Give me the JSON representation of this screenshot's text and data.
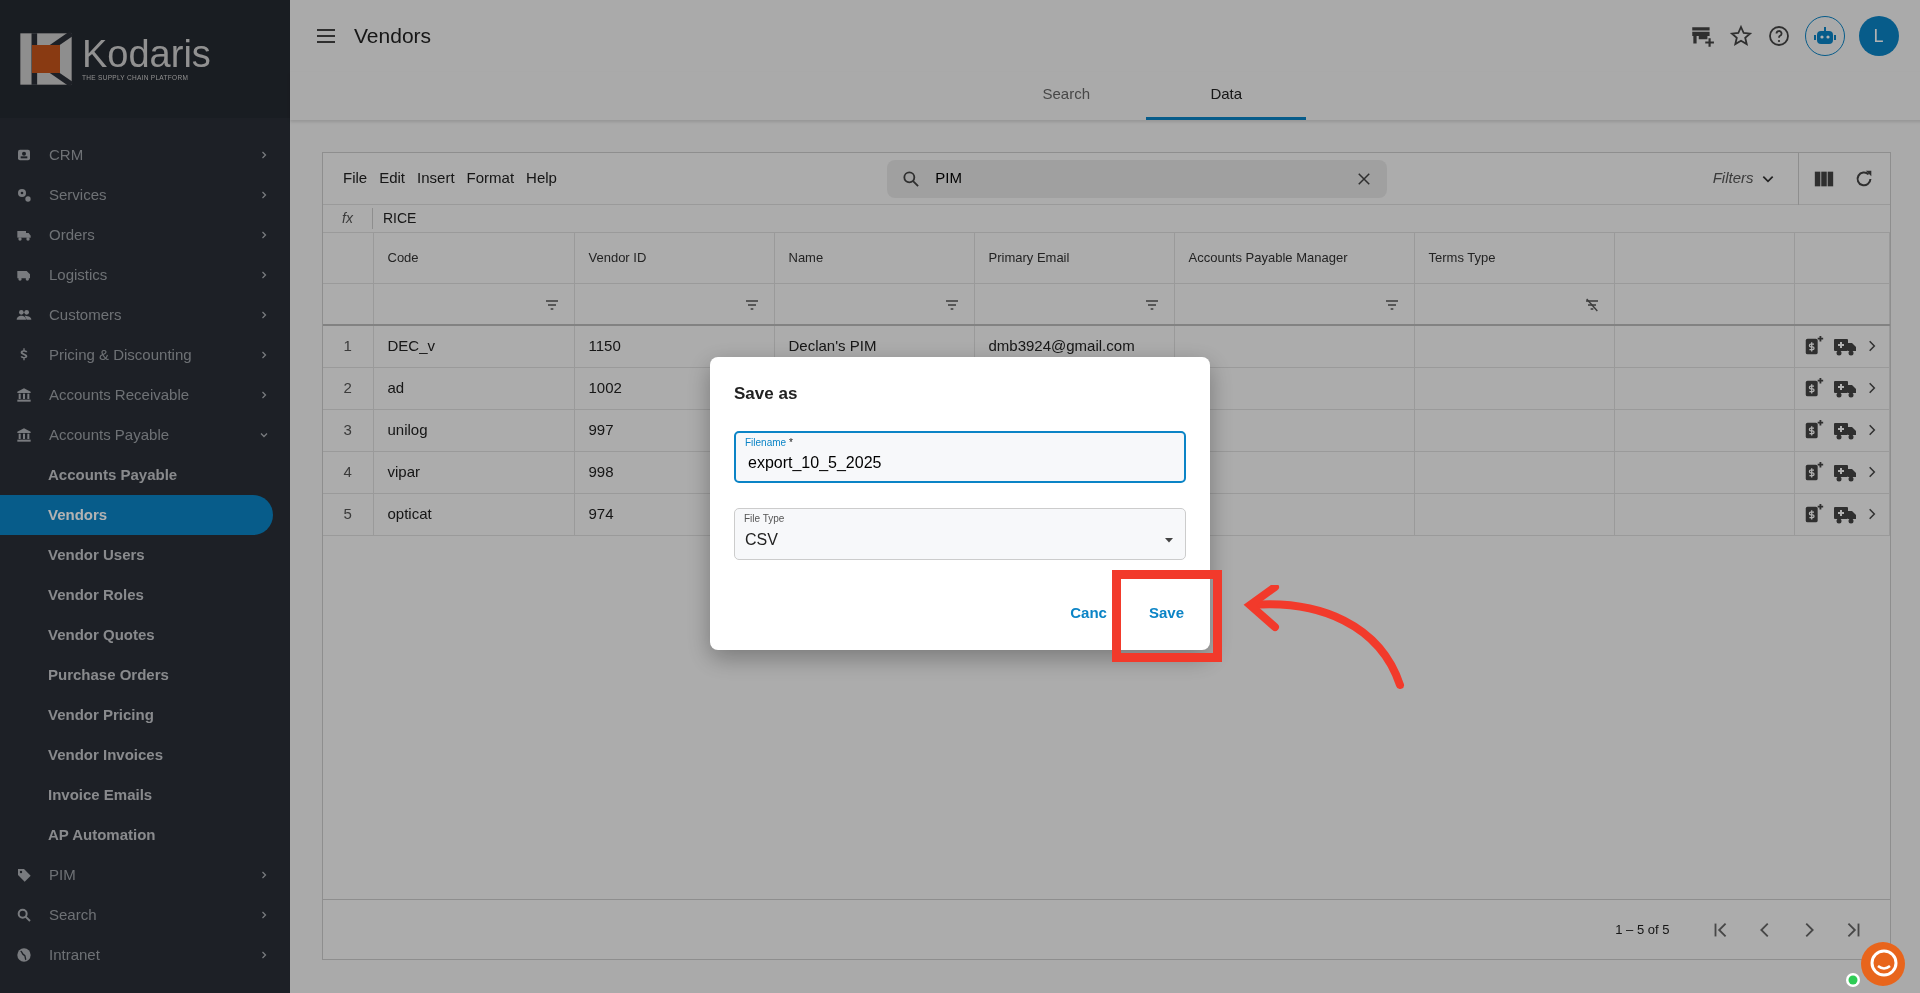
{
  "sidebar": {
    "logo": {
      "name": "Kodaris",
      "tagline": "THE SUPPLY CHAIN PLATFORM"
    },
    "items": [
      {
        "label": "CRM",
        "expanded": false
      },
      {
        "label": "Services",
        "expanded": false
      },
      {
        "label": "Orders",
        "expanded": false
      },
      {
        "label": "Logistics",
        "expanded": false
      },
      {
        "label": "Customers",
        "expanded": false
      },
      {
        "label": "Pricing & Discounting",
        "expanded": false
      },
      {
        "label": "Accounts Receivable",
        "expanded": false
      },
      {
        "label": "Accounts Payable",
        "expanded": true,
        "children": [
          {
            "label": "Accounts Payable",
            "selected": false
          },
          {
            "label": "Vendors",
            "selected": true
          },
          {
            "label": "Vendor Users",
            "selected": false
          },
          {
            "label": "Vendor Roles",
            "selected": false
          },
          {
            "label": "Vendor Quotes",
            "selected": false
          },
          {
            "label": "Purchase Orders",
            "selected": false
          },
          {
            "label": "Vendor Pricing",
            "selected": false
          },
          {
            "label": "Vendor Invoices",
            "selected": false
          },
          {
            "label": "Invoice Emails",
            "selected": false
          },
          {
            "label": "AP Automation",
            "selected": false
          }
        ]
      },
      {
        "label": "PIM",
        "expanded": false
      },
      {
        "label": "Search",
        "expanded": false
      },
      {
        "label": "Intranet",
        "expanded": false
      }
    ]
  },
  "header": {
    "title": "Vendors",
    "avatar": "L"
  },
  "tabs": [
    {
      "label": "Search",
      "selected": false
    },
    {
      "label": "Data",
      "selected": true
    }
  ],
  "grid": {
    "menu": [
      "File",
      "Edit",
      "Insert",
      "Format",
      "Help"
    ],
    "search": {
      "value": "PIM"
    },
    "filters": "Filters",
    "formula": {
      "label": "fx",
      "value": "RICE"
    },
    "columns": [
      {
        "label": "Code",
        "filter_off": false
      },
      {
        "label": "Vendor ID",
        "filter_off": false
      },
      {
        "label": "Name",
        "filter_off": false
      },
      {
        "label": "Primary Email",
        "filter_off": false
      },
      {
        "label": "Accounts Payable Manager",
        "filter_off": false
      },
      {
        "label": "Terms Type",
        "filter_off": true
      }
    ],
    "rows": [
      {
        "num": "1",
        "code": "DEC_v",
        "vendor_id": "1150",
        "name": "Declan's PIM",
        "email": "dmb3924@gmail.com"
      },
      {
        "num": "2",
        "code": "ad",
        "vendor_id": "1002"
      },
      {
        "num": "3",
        "code": "unilog",
        "vendor_id": "997"
      },
      {
        "num": "4",
        "code": "vipar",
        "vendor_id": "998"
      },
      {
        "num": "5",
        "code": "opticat",
        "vendor_id": "974"
      }
    ],
    "pagination": "1 – 5 of 5"
  },
  "dialog": {
    "title": "Save as",
    "filename": {
      "label": "Filename",
      "required_mark": "*",
      "value": "export_10_5_2025",
      "focused": true
    },
    "file_type": {
      "label": "File Type",
      "value": "CSV",
      "focused": false
    },
    "buttons": [
      "Canc",
      "Save"
    ]
  }
}
